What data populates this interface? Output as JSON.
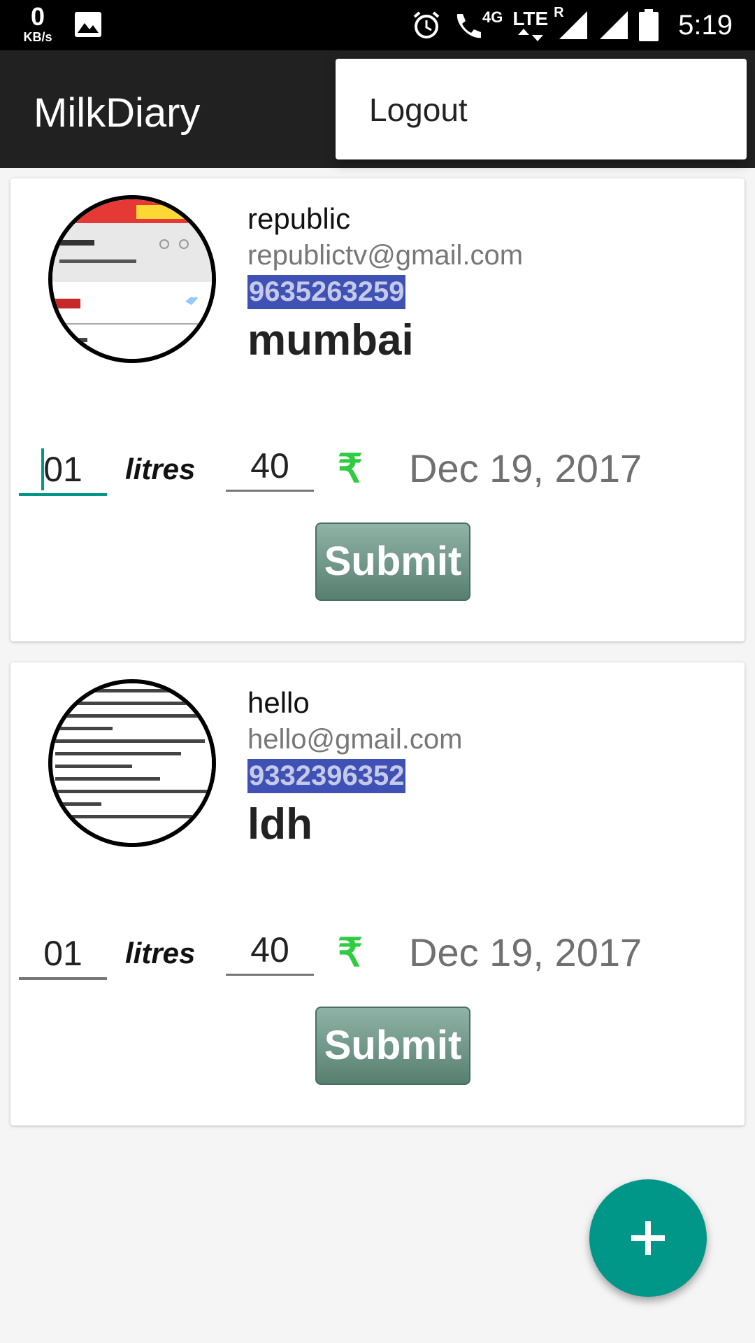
{
  "status_bar": {
    "net_speed": "0",
    "net_unit": "KB/s",
    "network_label": "4G",
    "lte_label": "LTE",
    "roaming_label": "R",
    "time": "5:19"
  },
  "toolbar": {
    "title": "MilkDiary"
  },
  "menu": {
    "items": [
      "Logout"
    ]
  },
  "cards": [
    {
      "name": "republic",
      "email": "republictv@gmail.com",
      "phone": "9635263259",
      "city": "mumbai",
      "quantity": "01",
      "unit": "litres",
      "price": "40",
      "currency_symbol": "₹",
      "date": "Dec 19, 2017",
      "submit_label": "Submit"
    },
    {
      "name": "hello",
      "email": "hello@gmail.com",
      "phone": "9332396352",
      "city": "ldh",
      "quantity": "01",
      "unit": "litres",
      "price": "40",
      "currency_symbol": "₹",
      "date": "Dec 19, 2017",
      "submit_label": "Submit"
    }
  ],
  "fab": {
    "icon": "plus-icon"
  },
  "colors": {
    "accent": "#009688",
    "toolbar": "#212121",
    "phone_highlight": "#3f51b5",
    "rupee": "#2ecc40"
  }
}
